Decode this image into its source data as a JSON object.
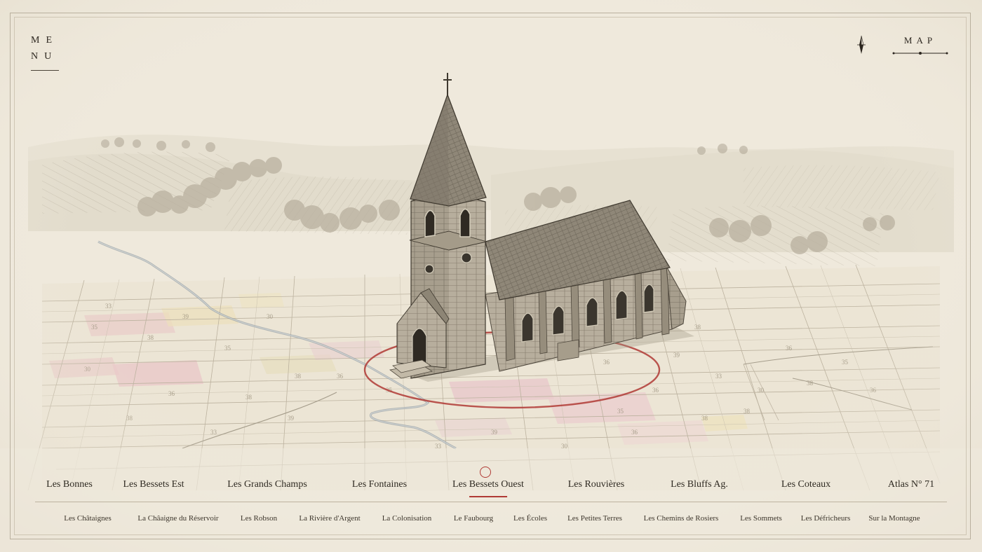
{
  "menu": {
    "line1": "ME",
    "line2": "NU"
  },
  "map_button": {
    "label": "MAP"
  },
  "compass_icon": "compass-rose-icon",
  "accent_color": "#b03a35",
  "districts": [
    {
      "label": "Les Bonnes",
      "active": false
    },
    {
      "label": "Les Bessets Est",
      "active": false
    },
    {
      "label": "Les Grands Champs",
      "active": false
    },
    {
      "label": "Les Fontaines",
      "active": false
    },
    {
      "label": "Les Bessets Ouest",
      "active": true
    },
    {
      "label": "Les Rouvières",
      "active": false
    },
    {
      "label": "Les Bluffs Ag.",
      "active": false
    },
    {
      "label": "Les Coteaux",
      "active": false
    },
    {
      "label": "Atlas N° 71",
      "active": false
    }
  ],
  "subdistricts": [
    "Les Châtaignes",
    "La Châaigne du Réservoir",
    "Les Robson",
    "La Rivière d'Argent",
    "La Colonisation",
    "Le Faubourg",
    "Les Écoles",
    "Les Petites Terres",
    "Les Chemins de Rosiers",
    "Les Sommets",
    "Les Défricheurs",
    "Sur la Montagne"
  ],
  "map": {
    "plot_numbers": [
      "33",
      "39",
      "38",
      "35",
      "30",
      "36",
      "38",
      "39",
      "33",
      "38",
      "36",
      "35",
      "38",
      "36",
      "39",
      "33",
      "36",
      "30",
      "38",
      "35",
      "35",
      "38",
      "36",
      "30",
      "39",
      "33",
      "38",
      "36",
      "35",
      "30",
      "38",
      "36"
    ]
  }
}
